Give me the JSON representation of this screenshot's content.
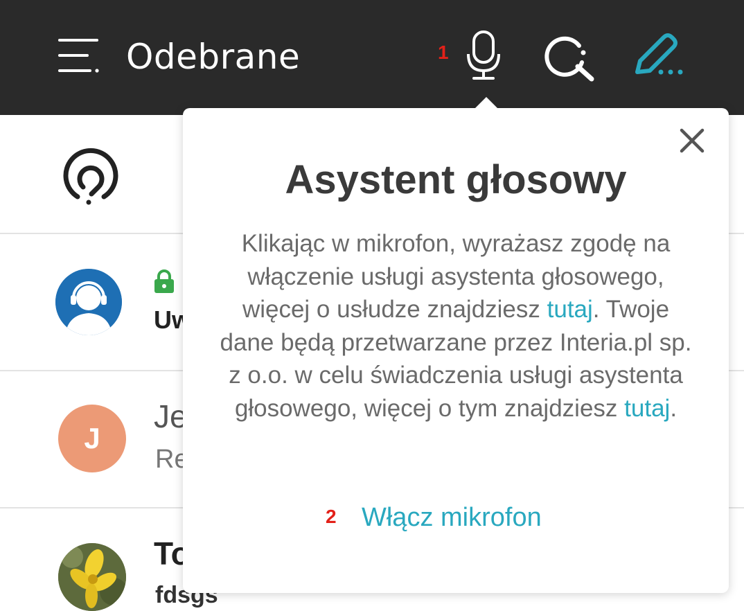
{
  "header": {
    "title": "Odebrane",
    "step_marker": "1",
    "icons": [
      "menu-icon",
      "microphone-icon",
      "search-icon",
      "compose-icon"
    ],
    "colors": {
      "background": "#2a2a2a",
      "compose_accent": "#29a8bf",
      "step_marker": "#e32119"
    }
  },
  "list": {
    "items": [
      {
        "avatar": "support-agent",
        "locked": true,
        "sender": "Uw"
      },
      {
        "avatar_letter": "J",
        "avatar_color": "#ec9a76",
        "sender": "Je",
        "snippet": "Re"
      },
      {
        "avatar": "flower-photo",
        "sender": "To",
        "snippet": "fdsgs"
      }
    ]
  },
  "popover": {
    "title": "Asystent głosowy",
    "body_part1": "Klikając w mikrofon, wyrażasz zgodę na włączenie usługi asystenta głosowego, więcej o usłudze znajdziesz ",
    "link1": "tutaj",
    "body_part2": ". Twoje dane będą przetwarzane przez Interia.pl sp. z o.o. w celu świadczenia usługi asystenta głosowego, więcej o tym znajdziesz ",
    "link2": "tutaj",
    "body_part3": ".",
    "step_marker": "2",
    "enable_label": "Włącz mikrofon",
    "link_color": "#29a8bf"
  }
}
